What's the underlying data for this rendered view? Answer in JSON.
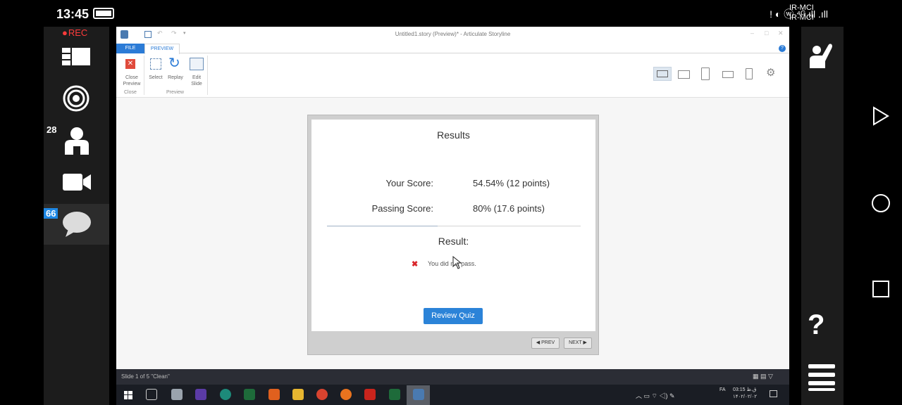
{
  "statusbar": {
    "time": "13:45",
    "right_icons": "! ◐ ⓦ ⁴ᴳ.ıll  .ıll",
    "carrier1": "IR-MCI",
    "carrier2": "IR-MCI"
  },
  "meeting": {
    "rec_label": "REC",
    "participants_count": "28",
    "chat_count": "66"
  },
  "window": {
    "title": "Untitled1.story (Preview)* - Articulate Storyline",
    "tabs": [
      "FILE",
      "PREVIEW"
    ],
    "ribbon": {
      "close_preview": "Close Preview",
      "close_group": "Close",
      "select": "Select",
      "replay": "Replay",
      "edit_slide": "Edit Slide",
      "preview_group": "Preview"
    },
    "status_text": "Slide 1 of 5   \"Clean\"",
    "tray_time": "03:15 ق.ظ",
    "tray_date": "۱۴۰۲/۰۲/۰۲",
    "tray_lang": "FA"
  },
  "slide": {
    "title": "Results",
    "your_score_label": "Your Score:",
    "your_score_value": "54.54% (12 points)",
    "passing_label": "Passing Score:",
    "passing_value": "80% (17.6 points)",
    "result_label": "Result:",
    "result_message": "You did not pass.",
    "review_button": "Review Quiz",
    "prev_button": "◀ PREV",
    "next_button": "NEXT ▶"
  },
  "colors": {
    "accent": "#2b83d8",
    "fail_red": "#d9262b",
    "rec_red": "#ff3b3b"
  }
}
